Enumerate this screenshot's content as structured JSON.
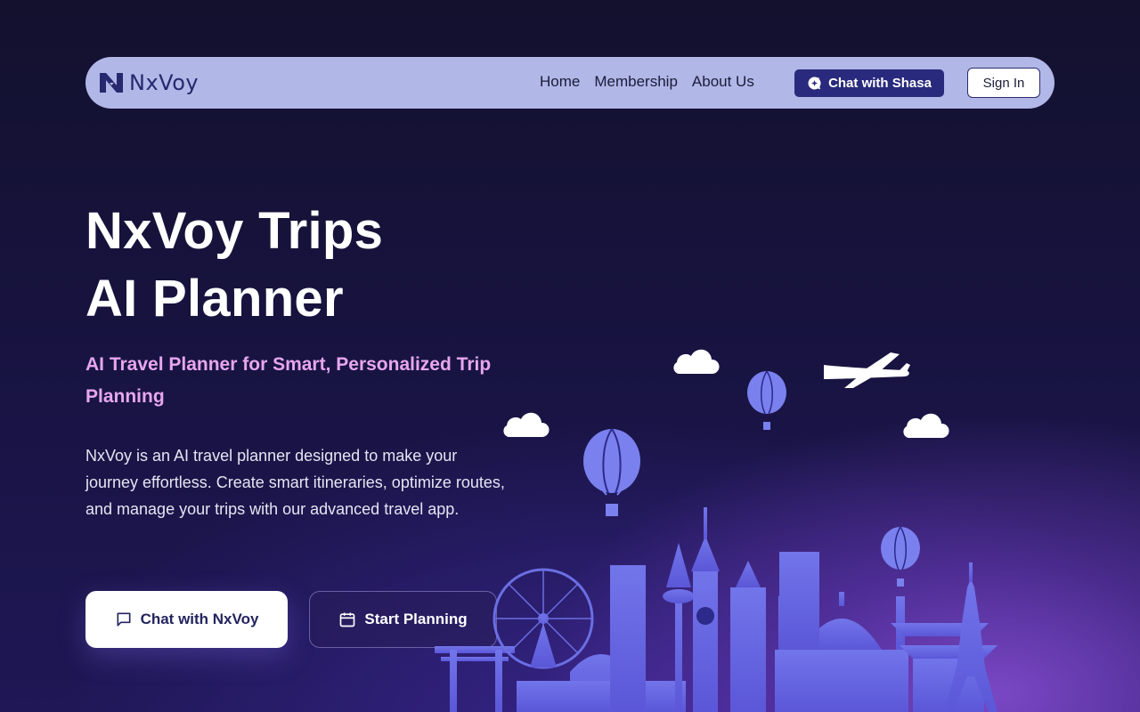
{
  "brand": {
    "name": "NxVoy"
  },
  "nav": {
    "links": [
      "Home",
      "Membership",
      "About Us"
    ],
    "chat_label": "Chat with Shasa",
    "signin_label": "Sign In"
  },
  "hero": {
    "title_line1": "NxVoy Trips",
    "title_line2": "AI Planner",
    "subtitle": "AI Travel Planner for Smart, Personalized Trip Planning",
    "description": "NxVoy is an AI travel planner designed to make your journey effortless. Create smart itineraries, optimize routes, and manage your trips with our advanced travel app.",
    "primary_button": "Chat with NxVoy",
    "secondary_button": "Start Planning"
  },
  "icons": {
    "chat_shasa": "chat-bubble-sparkle-icon",
    "primary": "message-square-icon",
    "secondary": "calendar-icon"
  },
  "colors": {
    "nav_bg": "#b1b7e7",
    "brand_dark": "#292a7d",
    "subtitle": "#e7a6ee",
    "skyline": "#6f73e6"
  }
}
